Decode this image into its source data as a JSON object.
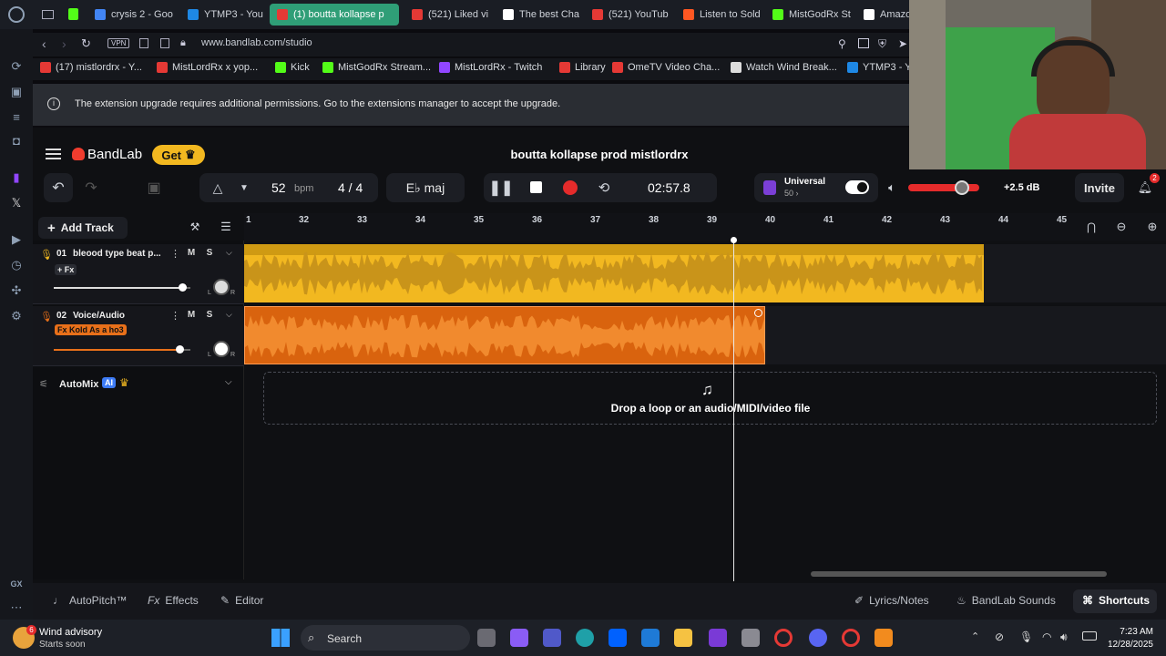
{
  "browser": {
    "tabs": [
      {
        "label": "crysis 2 - Goo",
        "color": "#4285f4"
      },
      {
        "label": "YTMP3 - You",
        "color": "#1e88e5"
      },
      {
        "label": "(1) boutta kollapse p",
        "color": "#e53935",
        "active": true
      },
      {
        "label": "(521) Liked vi",
        "color": "#e53935"
      },
      {
        "label": "The best Cha",
        "color": "#ffffff"
      },
      {
        "label": "(521) YouTub",
        "color": "#e53935"
      },
      {
        "label": "Listen to Sold",
        "color": "#ff5722"
      },
      {
        "label": "MistGodRx St",
        "color": "#53fc18"
      },
      {
        "label": "Amazon",
        "color": "#ffffff"
      }
    ],
    "url": "www.bandlab.com/studio",
    "vpn_label": "VPN",
    "bookmarks": [
      {
        "label": "(17) mistlordrx - Y...",
        "color": "#e53935"
      },
      {
        "label": "MistLordRx x yop...",
        "color": "#e53935"
      },
      {
        "label": "Kick",
        "color": "#53fc18"
      },
      {
        "label": "MistGodRx Stream...",
        "color": "#53fc18"
      },
      {
        "label": "MistLordRx - Twitch",
        "color": "#9146ff"
      },
      {
        "label": "Library",
        "color": "#e53935"
      },
      {
        "label": "OmeTV Video Cha...",
        "color": "#e53935"
      },
      {
        "label": "Watch Wind Break...",
        "color": "#dddddd"
      },
      {
        "label": "YTMP3 - Y",
        "color": "#1e88e5"
      }
    ],
    "notice": "The extension upgrade requires additional permissions. Go to the extensions manager to accept the upgrade."
  },
  "app": {
    "brand": "BandLab",
    "get_label": "Get",
    "project_title": "boutta kollapse prod mistlordrx",
    "bpm": "52",
    "bpm_unit": "bpm",
    "time_sig": "4 / 4",
    "key": "E♭ maj",
    "time": "02:57.8",
    "universal_label": "Universal",
    "universal_value": "50",
    "gain": "+2.5 dB",
    "invite": "Invite",
    "notif_count": "2",
    "add_track": "Add Track",
    "ruler": [
      "1",
      "32",
      "33",
      "34",
      "35",
      "36",
      "37",
      "38",
      "39",
      "40",
      "41",
      "42",
      "43",
      "44",
      "45"
    ],
    "tracks": [
      {
        "num": "01",
        "name": "bleood type beat p...",
        "fx": "+ Fx",
        "mute": "M",
        "solo": "S",
        "pan_l": "L",
        "pan_r": "R",
        "volume": 0.94,
        "color": "#f2b820"
      },
      {
        "num": "02",
        "name": "Voice/Audio",
        "fx": "Fx Kold As a ho3",
        "mute": "M",
        "solo": "S",
        "pan_l": "L",
        "pan_r": "R",
        "volume": 0.92,
        "color": "#e8701a"
      }
    ],
    "automix": "AutoMix",
    "ai_badge": "AI",
    "drop_text": "Drop a loop or an audio/MIDI/video file",
    "bottom_left": [
      "AutoPitch™",
      "Effects",
      "Editor"
    ],
    "bottom_right": [
      "Lyrics/Notes",
      "BandLab Sounds",
      "Shortcuts"
    ]
  },
  "taskbar": {
    "weather_title": "Wind advisory",
    "weather_sub": "Starts soon",
    "weather_badge": "6",
    "search": "Search",
    "time": "7:23 AM",
    "date": "12/28/2025"
  },
  "sidebar": {
    "gx_label": "GX"
  }
}
